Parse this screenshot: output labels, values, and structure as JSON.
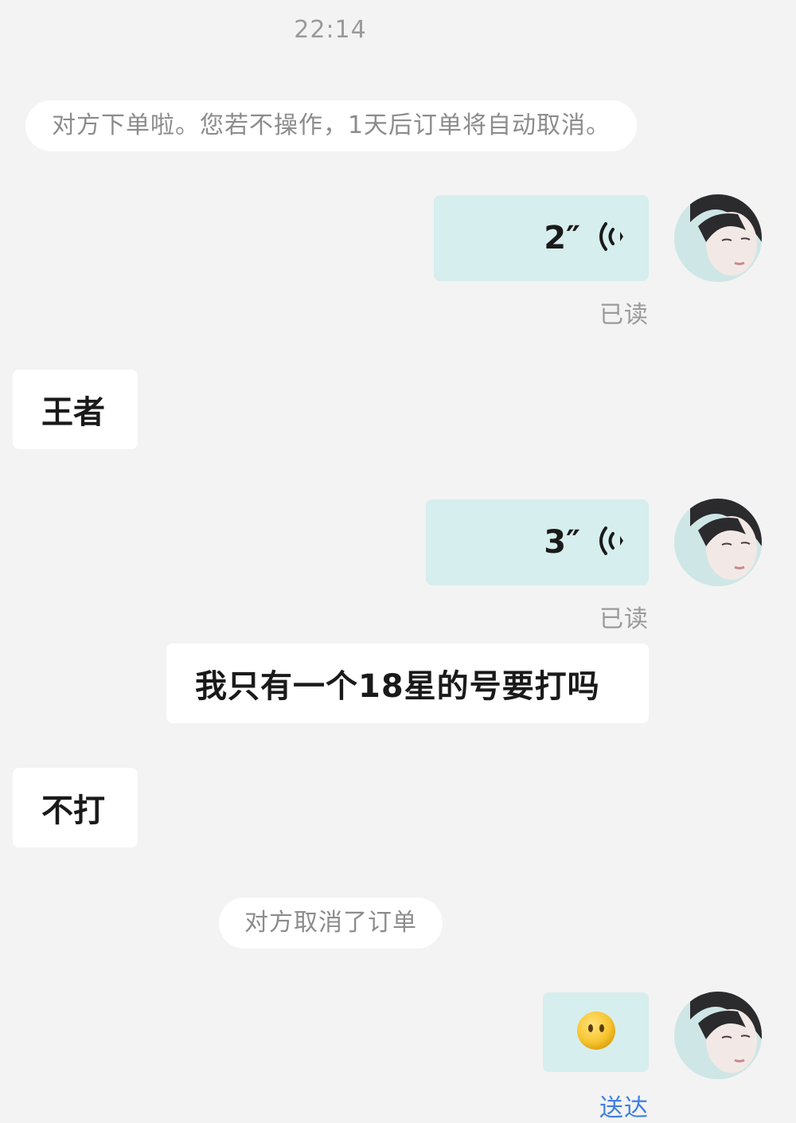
{
  "timestamp": "22:14",
  "system_order_placed": "对方下单啦。您若不操作，1天后订单将自动取消。",
  "system_order_cancelled": "对方取消了订单",
  "messages": [
    {
      "side": "out",
      "type": "voice",
      "duration": "2″",
      "status": "已读"
    },
    {
      "side": "in",
      "type": "text",
      "text": "王者"
    },
    {
      "side": "out",
      "type": "voice",
      "duration": "3″",
      "status": "已读"
    },
    {
      "side": "out",
      "type": "text",
      "text": "我只有一个18星的号要打吗"
    },
    {
      "side": "in",
      "type": "text",
      "text": "不打"
    },
    {
      "side": "out",
      "type": "emoji",
      "emoji": "neutral-face-no-mouth",
      "status": "送达"
    }
  ],
  "colors": {
    "background": "#f3f3f3",
    "outgoing_bubble": "#d6eeed",
    "incoming_bubble": "#ffffff",
    "status_read": "#9a9a9a",
    "status_delivered": "#3f7fe0"
  },
  "icons": [
    "voice-wave-icon",
    "emoji-face-icon",
    "avatar"
  ]
}
